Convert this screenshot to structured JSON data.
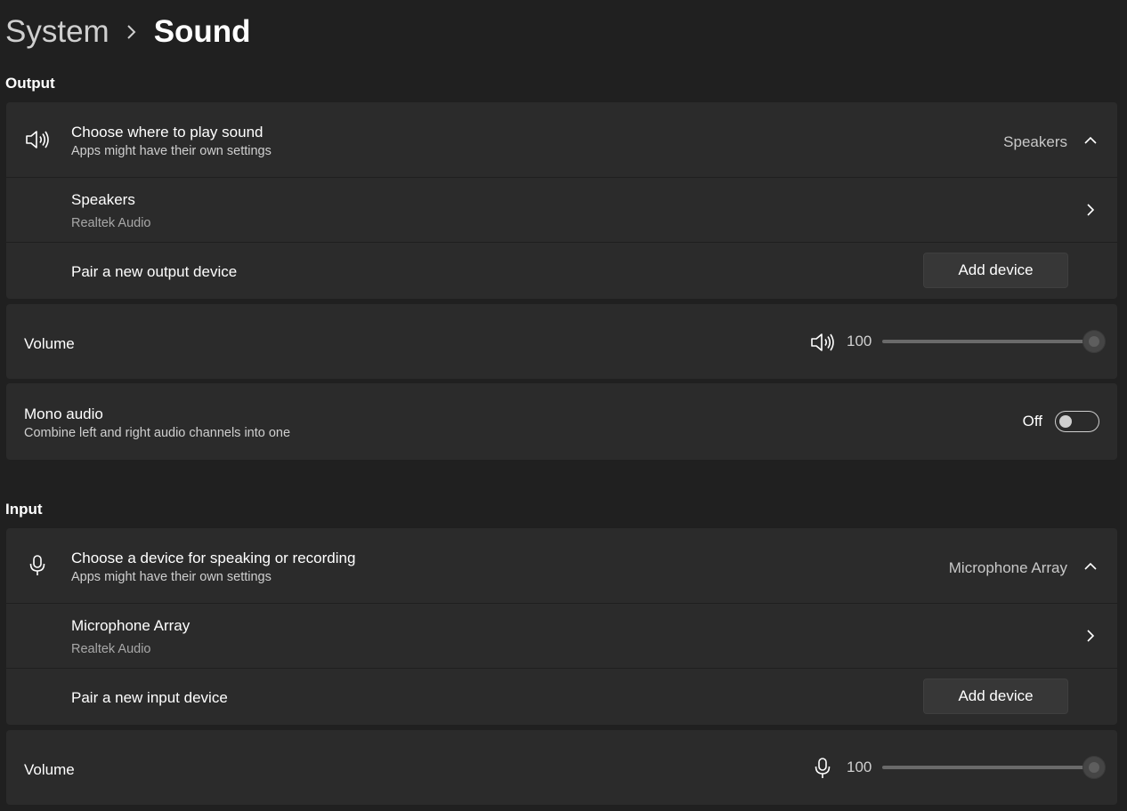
{
  "breadcrumb": {
    "parent": "System",
    "current": "Sound"
  },
  "output": {
    "section_title": "Output",
    "choose": {
      "title": "Choose where to play sound",
      "subtitle": "Apps might have their own settings",
      "selected": "Speakers"
    },
    "device": {
      "name": "Speakers",
      "driver": "Realtek Audio"
    },
    "pair": {
      "label": "Pair a new output device",
      "button": "Add device"
    },
    "volume": {
      "label": "Volume",
      "value": "100",
      "level": 100
    },
    "mono": {
      "title": "Mono audio",
      "subtitle": "Combine left and right audio channels into one",
      "state": "Off"
    }
  },
  "input": {
    "section_title": "Input",
    "choose": {
      "title": "Choose a device for speaking or recording",
      "subtitle": "Apps might have their own settings",
      "selected": "Microphone Array"
    },
    "device": {
      "name": "Microphone Array",
      "driver": "Realtek Audio"
    },
    "pair": {
      "label": "Pair a new input device",
      "button": "Add device"
    },
    "volume": {
      "label": "Volume",
      "value": "100",
      "level": 100
    }
  },
  "icons": {
    "speaker": "speaker-icon",
    "microphone": "microphone-icon",
    "chevron_up": "chevron-up-icon",
    "chevron_right": "chevron-right-icon"
  }
}
